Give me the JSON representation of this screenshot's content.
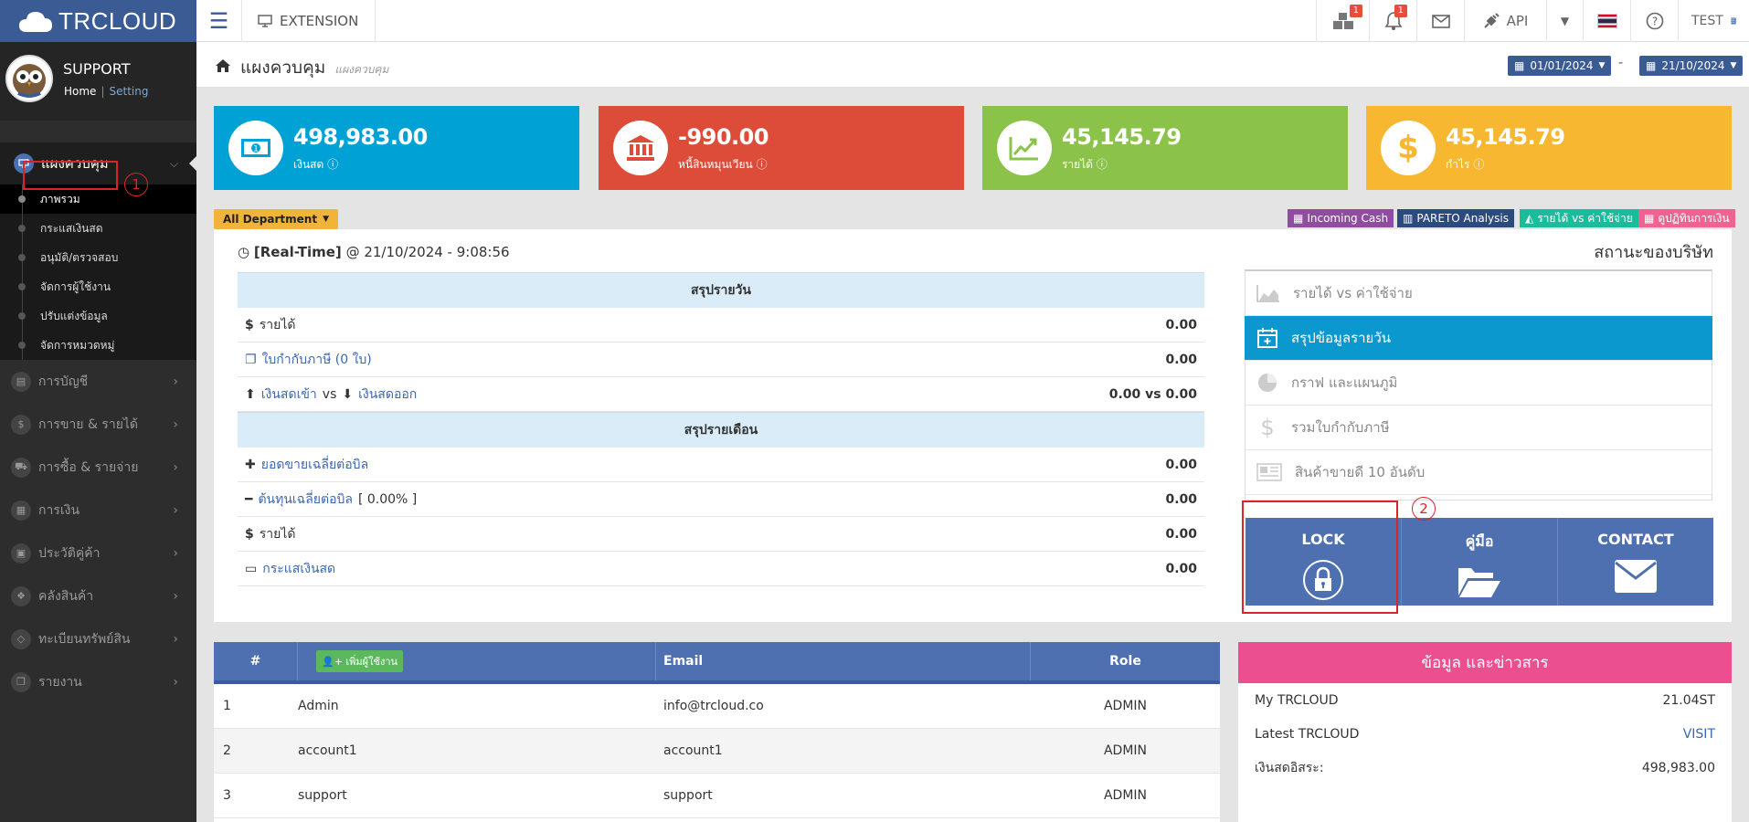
{
  "app": {
    "logo_text": "TRCLOUD",
    "extension_label": "EXTENSION"
  },
  "topbar": {
    "cart_badge": "1",
    "bell_badge": "1",
    "api_label": "API",
    "user_label": "TEST"
  },
  "profile": {
    "name": "SUPPORT",
    "home_link": "Home",
    "setting_link": "Setting"
  },
  "sidebar": {
    "active_menu": "แผงควบคุม",
    "submenu": [
      "ภาพรวม",
      "กระแสเงินสด",
      "อนุมัติ/ตรวจสอบ",
      "จัดการผู้ใช้งาน",
      "ปรับแต่งข้อมูล",
      "จัดการหมวดหมู่"
    ],
    "items": [
      "การบัญชี",
      "การขาย & รายได้",
      "การซื้อ & รายจ่าย",
      "การเงิน",
      "ประวัติคู่ค้า",
      "คลังสินค้า",
      "ทะเบียนทรัพย์สิน",
      "รายงาน"
    ]
  },
  "annotations": {
    "one": "1",
    "two": "2"
  },
  "page": {
    "title": "แผงควบคุม",
    "subtitle": "แผงควบคุม",
    "date_from": "01/01/2024",
    "date_to": "21/10/2024",
    "date_sep": "-"
  },
  "stats": [
    {
      "value": "498,983.00",
      "label": "เงินสด",
      "color": "#00a2d5"
    },
    {
      "value": "-990.00",
      "label": "หนี้สินหมุนเวียน",
      "color": "#dd4b39"
    },
    {
      "value": "45,145.79",
      "label": "รายได้",
      "color": "#8bc34a"
    },
    {
      "value": "45,145.79",
      "label": "กำไร",
      "color": "#f7b731"
    }
  ],
  "filters": {
    "department": "All Department",
    "incoming_cash": "Incoming Cash",
    "pareto": "PARETO Analysis",
    "income_vs_expense": "รายได้ vs ค่าใช้จ่าย",
    "calendar": "ดูปฏิทินการเงิน"
  },
  "realtime": {
    "label": "[Real-Time]",
    "at": "@ 21/10/2024 - 9:08:56"
  },
  "company_status": "สถานะของบริษัท",
  "daily": {
    "header": "สรุปรายวัน",
    "income_label": "รายได้",
    "income_value": "0.00",
    "tax_label": "ใบกำกับภาษี (0 ใบ)",
    "tax_value": "0.00",
    "cash_in_label": "เงินสดเข้า",
    "vs": "vs",
    "cash_out_label": "เงินสดออก",
    "cash_value": "0.00 vs 0.00"
  },
  "monthly": {
    "header": "สรุปรายเดือน",
    "avg_sales_label": "ยอดขายเฉลี่ยต่อบิล",
    "avg_sales_value": "0.00",
    "avg_cost_label": "ต้นทุนเฉลี่ยต่อบิล",
    "avg_cost_pct": "[ 0.00% ]",
    "avg_cost_value": "0.00",
    "income_label": "รายได้",
    "income_value": "0.00",
    "cashflow_label": "กระแสเงินสด",
    "cashflow_value": "0.00"
  },
  "side_menu": [
    "รายได้ vs ค่าใช้จ่าย",
    "สรุปข้อมูลรายวัน",
    "กราฟ และแผนภูมิ",
    "รวมใบกำกับภาษี",
    "สินค้าขายดี 10 อันดับ"
  ],
  "tiles": {
    "lock": "LOCK",
    "manual": "คู่มือ",
    "contact": "CONTACT"
  },
  "users_table": {
    "headers": {
      "num": "#",
      "add": "เพิ่มผู้ใช้งาน",
      "email": "Email",
      "role": "Role"
    },
    "rows": [
      {
        "num": "1",
        "name": "Admin",
        "email": "info@trcloud.co",
        "role": "ADMIN"
      },
      {
        "num": "2",
        "name": "account1",
        "email": "account1",
        "role": "ADMIN"
      },
      {
        "num": "3",
        "name": "support",
        "email": "support",
        "role": "ADMIN"
      }
    ]
  },
  "news": {
    "header": "ข้อมูล และข่าวสาร",
    "rows": [
      {
        "label": "My TRCLOUD",
        "value": "21.04ST"
      },
      {
        "label": "Latest TRCLOUD",
        "value": "VISIT"
      },
      {
        "label": "เงินสดอิสระ:",
        "value": "498,983.00"
      }
    ]
  }
}
